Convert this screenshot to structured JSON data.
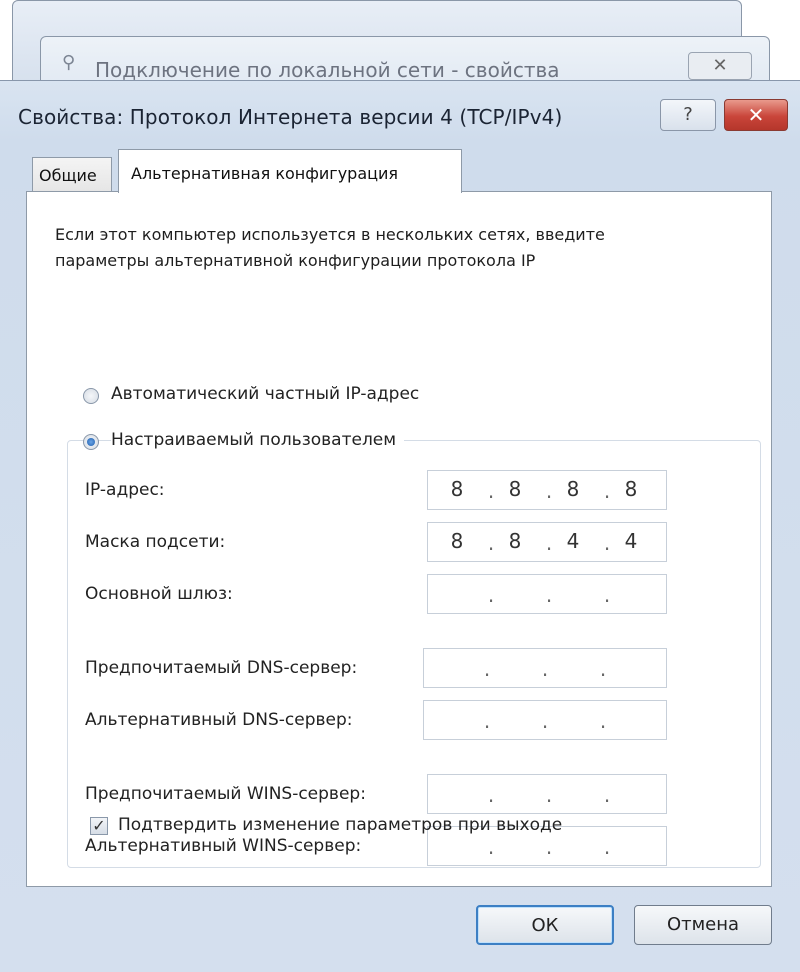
{
  "background_windows": {
    "title": "Подключение по локальной сети - свойства",
    "close_glyph": "✕",
    "icon": "network-icon"
  },
  "dialog": {
    "title": "Свойства: Протокол Интернета версии 4 (TCP/IPv4)",
    "help_label": "?",
    "close_label": "✕"
  },
  "tabs": [
    {
      "label": "Общие",
      "active": false
    },
    {
      "label": "Альтернативная конфигурация",
      "active": true
    }
  ],
  "panel": {
    "intro_line1": "Если этот компьютер используется в нескольких сетях, введите",
    "intro_line2": "параметры альтернативной конфигурации протокола IP",
    "radio_auto_label": "Автоматический частный IP-адрес",
    "radio_auto_checked": false,
    "radio_user_label": "Настраиваемый пользователем",
    "radio_user_checked": true,
    "fields": [
      {
        "label": "IP-адрес:",
        "octets": [
          "8",
          "8",
          "8",
          "8"
        ]
      },
      {
        "label": "Маска подсети:",
        "octets": [
          "8",
          "8",
          "4",
          "4"
        ]
      },
      {
        "label": "Основной шлюз:",
        "octets": [
          "",
          "",
          "",
          ""
        ]
      },
      {
        "label": "Предпочитаемый DNS-сервер:",
        "octets": [
          "",
          "",
          "",
          ""
        ]
      },
      {
        "label": "Альтернативный DNS-сервер:",
        "octets": [
          "",
          "",
          "",
          ""
        ]
      },
      {
        "label": "Предпочитаемый WINS-сервер:",
        "octets": [
          "",
          "",
          "",
          ""
        ]
      },
      {
        "label": "Альтернативный WINS-сервер:",
        "octets": [
          "",
          "",
          "",
          ""
        ]
      }
    ],
    "dot": ".",
    "validate_label": "Подтвердить изменение параметров при выходе",
    "validate_checked": true,
    "check_glyph": "✓"
  },
  "buttons": {
    "ok": "ОК",
    "cancel": "Отмена"
  }
}
